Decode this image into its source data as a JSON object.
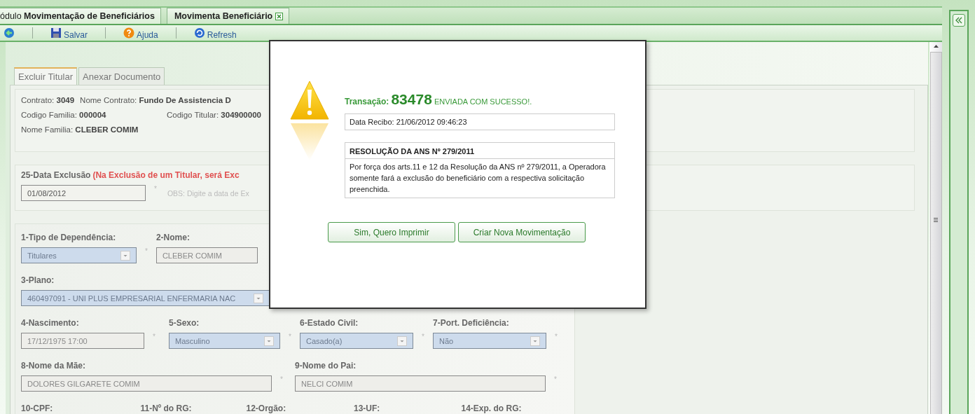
{
  "module_tabs": [
    {
      "label": "ódulo **Movimentação de Beneficiários**",
      "selected": false,
      "closable": false
    },
    {
      "label": "Movimenta Beneficiário",
      "selected": true,
      "closable": true
    }
  ],
  "toolbar": [
    {
      "kind": "back"
    },
    {
      "kind": "save",
      "label": "Salvar"
    },
    {
      "kind": "help",
      "label": "Ajuda"
    },
    {
      "kind": "refresh",
      "label": "Refresh"
    }
  ],
  "form_tabs": [
    {
      "label": "Excluir Titular",
      "selected": true
    },
    {
      "label": "Anexar Documento",
      "selected": false
    }
  ],
  "contract_info": [
    [
      {
        "label": "Contrato:",
        "value": "3049"
      },
      {
        "label": "Nome Contrato:",
        "value": "Fundo De Assistencia D"
      }
    ],
    [
      {
        "label": "Codigo Familia:",
        "value": "000004"
      },
      {
        "label": "Codigo Titular:",
        "value": "304900000"
      }
    ],
    [
      {
        "label": "Nome Familia:",
        "value": "CLEBER COMIM"
      }
    ]
  ],
  "exclusion": {
    "label": "25-Data Exclusão",
    "warning": "(Na Exclusão de um Titular, será Exc",
    "value": "01/08/2012",
    "mark": "*",
    "hint": "OBS: Digite a data de Ex"
  },
  "field_rows": [
    [
      {
        "label": "1-Tipo de Dependência:",
        "kind": "select",
        "value": "Titulares",
        "mark": "*"
      },
      {
        "label": "2-Nome:",
        "kind": "text",
        "value": "CLEBER COMIM"
      }
    ],
    [
      {
        "label": "3-Plano:",
        "kind": "select-wide",
        "value": "460497091 - UNI PLUS EMPRESARIAL ENFERMARIA NAC"
      }
    ],
    [
      {
        "label": "4-Nascimento:",
        "kind": "text",
        "value": "17/12/1975 17:00",
        "mark": "*"
      },
      {
        "label": "5-Sexo:",
        "kind": "select",
        "value": "Masculino",
        "mark": "*"
      },
      {
        "label": "6-Estado Civil:",
        "kind": "select",
        "value": "Casado(a)",
        "mark": "*"
      },
      {
        "label": "7-Port. Deficiência:",
        "kind": "select",
        "value": "Não",
        "mark": "*"
      }
    ],
    [
      {
        "label": "8-Nome da Mãe:",
        "kind": "text-wide",
        "value": "DOLORES GILGARETE COMIM",
        "mark": "*"
      },
      {
        "label": "9-Nome do Pai:",
        "kind": "text-wide",
        "value": "NELCI COMIM",
        "mark": "*"
      }
    ],
    [
      {
        "label": "10-CPF:",
        "kind": "label"
      },
      {
        "label": "11-Nº do RG:",
        "kind": "label"
      },
      {
        "label": "12-Orgão:",
        "kind": "label"
      },
      {
        "label": "13-UF:",
        "kind": "label"
      },
      {
        "label": "14-Exp. do RG:",
        "kind": "label"
      }
    ]
  ],
  "modal": {
    "transaction_label": "Transação:",
    "transaction_number": "83478",
    "status": "ENVIADA COM SUCESSO!.",
    "receipt": "Data Recibo: 21/06/2012 09:46:23",
    "notice_title": "RESOLUÇÃO DA ANS Nº 279/2011",
    "notice_text": "Por força dos arts.11 e 12 da Resolução da ANS nº 279/2011, a Operadora somente fará a exclusão do beneficiário com a respectiva solicitação preenchida.",
    "buttons": [
      "Sim, Quero Imprimir",
      "Criar Nova Movimentação"
    ]
  }
}
